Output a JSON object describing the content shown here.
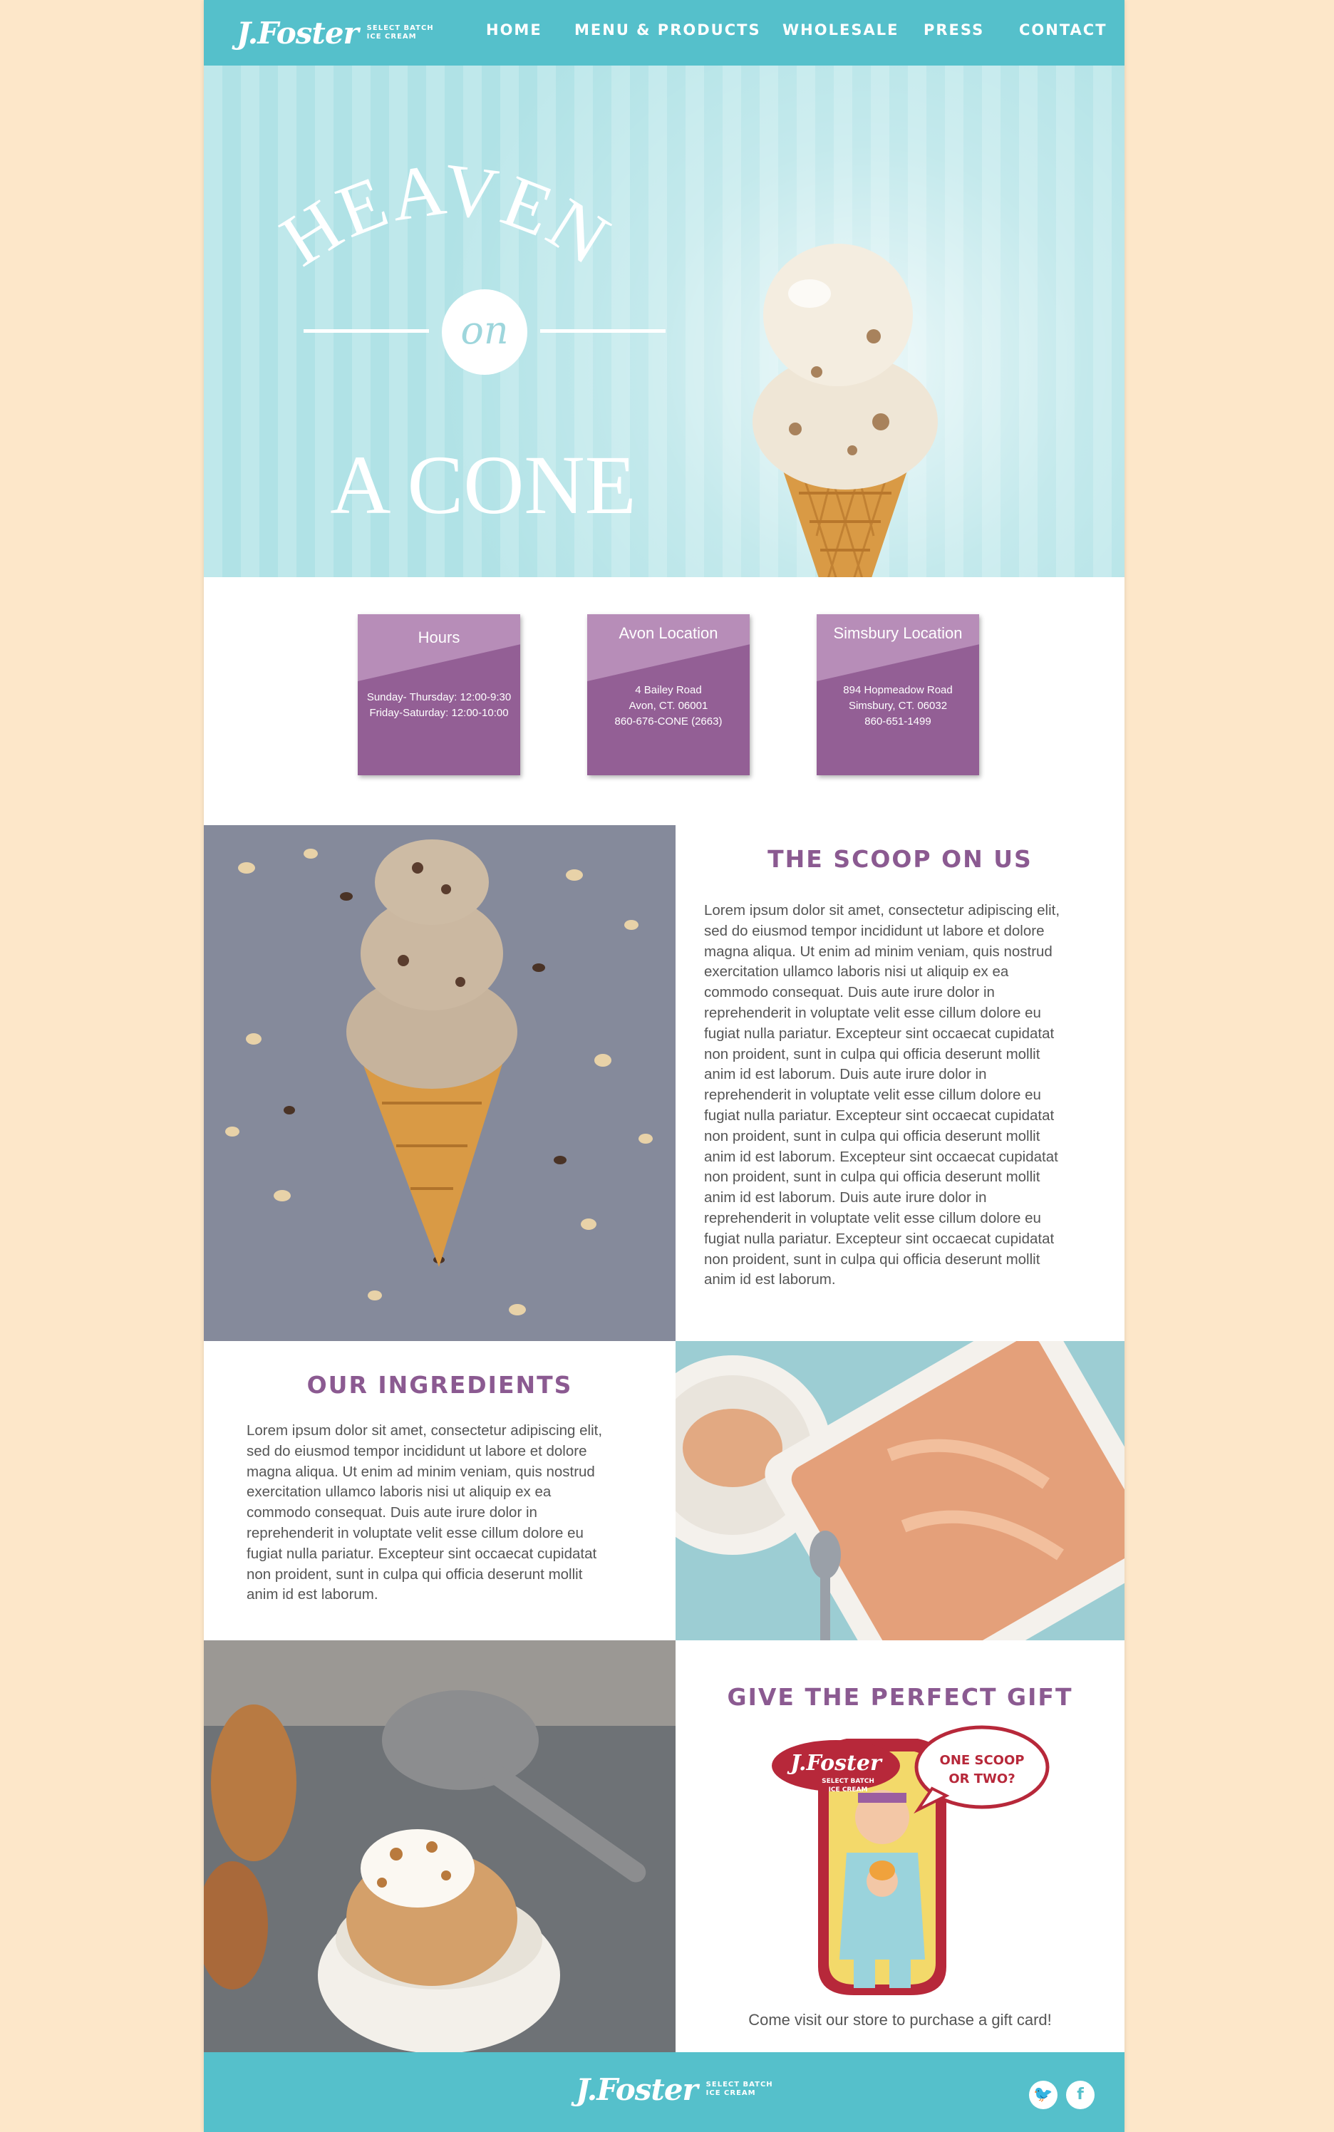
{
  "brand": {
    "logo_script": "J.Foster",
    "logo_line1": "SELECT BATCH",
    "logo_line2": "ICE CREAM"
  },
  "nav": {
    "items": [
      {
        "label": "HOME"
      },
      {
        "label": "MENU & PRODUCTS"
      },
      {
        "label": "WHOLESALE"
      },
      {
        "label": "PRESS"
      },
      {
        "label": "CONTACT"
      }
    ]
  },
  "hero": {
    "line1": "HEAVEN",
    "line2": "on",
    "line3": "A CONE"
  },
  "info_cards": [
    {
      "title": "Hours",
      "lines": [
        "Sunday- Thursday: 12:00-9:30",
        "Friday-Saturday: 12:00-10:00"
      ]
    },
    {
      "title": "Avon Location",
      "lines": [
        "4 Bailey Road",
        "Avon, CT. 06001",
        "860-676-CONE  (2663)"
      ]
    },
    {
      "title": "Simsbury Location",
      "lines": [
        "894 Hopmeadow Road",
        "Simsbury, CT. 06032",
        "860-651-1499"
      ]
    }
  ],
  "scoop": {
    "title": "THE SCOOP ON US",
    "lines": [
      "Lorem ipsum dolor sit amet, consectetur adipiscing elit,",
      "sed do eiusmod tempor incididunt ut labore et dolore",
      "magna aliqua. Ut enim ad minim veniam, quis nostrud",
      "exercitation ullamco laboris nisi ut aliquip ex ea",
      "commodo consequat. Duis aute irure dolor in",
      "reprehenderit in voluptate velit esse cillum dolore eu",
      "fugiat nulla pariatur. Excepteur sint occaecat cupidatat",
      "non proident, sunt in culpa qui officia deserunt mollit",
      "anim id est laborum. Duis aute irure dolor in",
      "reprehenderit in voluptate velit esse cillum dolore eu",
      "fugiat nulla pariatur. Excepteur sint occaecat cupidatat",
      "non proident, sunt in culpa qui officia deserunt mollit",
      "anim id est laborum. Excepteur sint occaecat cupidatat",
      "non proident, sunt in culpa qui officia deserunt mollit",
      "anim id est laborum. Duis aute irure dolor in",
      "reprehenderit in voluptate velit esse cillum dolore eu",
      "fugiat nulla pariatur. Excepteur sint occaecat cupidatat",
      "non proident, sunt in culpa qui officia deserunt mollit",
      "anim id est laborum."
    ]
  },
  "ingredients": {
    "title": "OUR INGREDIENTS",
    "lines": [
      "Lorem ipsum dolor sit amet, consectetur adipiscing elit,",
      "sed do eiusmod tempor incididunt ut labore et dolore",
      "magna aliqua. Ut enim ad minim veniam, quis nostrud",
      "exercitation ullamco laboris nisi ut aliquip ex ea",
      "commodo consequat. Duis aute irure dolor in",
      "reprehenderit in voluptate velit esse cillum dolore eu",
      "fugiat nulla pariatur. Excepteur sint occaecat cupidatat",
      "non proident, sunt in culpa qui officia deserunt mollit",
      "anim id est laborum."
    ]
  },
  "gift": {
    "title": "GIVE THE PERFECT GIFT",
    "logo_script": "J.Foster",
    "logo_sub1": "SELECT BATCH",
    "logo_sub2": "ICE CREAM",
    "bubble1": "ONE SCOOP",
    "bubble2": "OR TWO?",
    "note": "Come visit our store to purchase a gift card!"
  },
  "footer": {
    "logo_script": "J.Foster",
    "logo_line1": "SELECT BATCH",
    "logo_line2": "ICE CREAM",
    "twitter_icon": "twitter-icon",
    "facebook_icon": "facebook-icon"
  },
  "colors": {
    "teal": "#55c0cb",
    "purple": "#935f95",
    "purple_light": "#b78db8",
    "page_bg": "#fde7c9"
  }
}
